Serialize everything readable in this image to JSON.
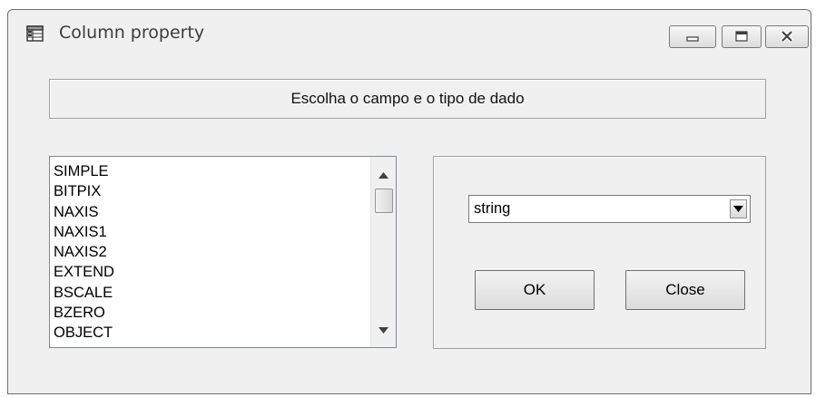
{
  "window": {
    "title": "Column property",
    "icon": "app-table-icon",
    "controls": [
      "minimize-icon",
      "maximize-icon",
      "close-icon"
    ]
  },
  "header": {
    "text": "Escolha o campo e o tipo de dado"
  },
  "field_list": {
    "items": [
      "SIMPLE",
      "BITPIX",
      "NAXIS",
      "NAXIS1",
      "NAXIS2",
      "EXTEND",
      "BSCALE",
      "BZERO",
      "OBJECT"
    ]
  },
  "type_select": {
    "value": "string"
  },
  "buttons": {
    "ok": "OK",
    "close": "Close"
  }
}
